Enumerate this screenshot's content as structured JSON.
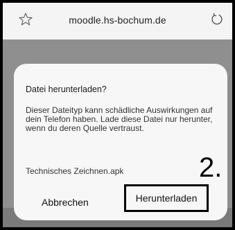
{
  "browser": {
    "url": "moodle.hs-bochum.de",
    "star_icon": "star-outline-icon",
    "reload_icon": "reload-icon"
  },
  "dialog": {
    "title": "Datei herunterladen?",
    "message": "Dieser Dateityp kann schädliche Auswirkungen auf dein Telefon haben. Lade diese Datei nur herunter, wenn du deren Quelle vertraust.",
    "file_name": "Technisches Zeichnen.apk",
    "cancel_label": "Abbrechen",
    "download_label": "Herunterladen"
  },
  "annotation": {
    "step_label": "2."
  }
}
